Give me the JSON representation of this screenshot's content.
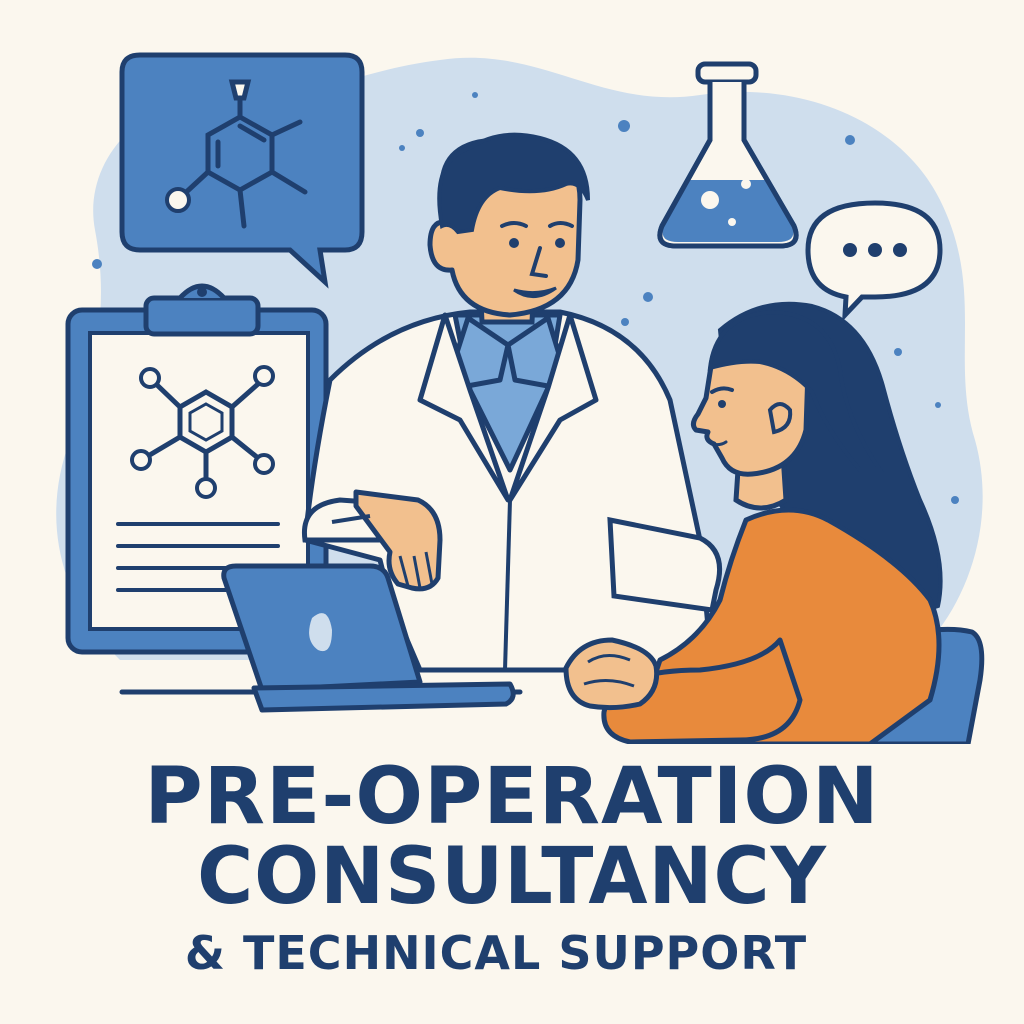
{
  "headline": {
    "line1": "PRE-OPERATION",
    "line2": "CONSULTANCY",
    "subtitle": "& TECHNICAL SUPPORT"
  },
  "colors": {
    "background": "#fbf7ee",
    "navy": "#1f3f6e",
    "blue": "#4c82c0",
    "light_blue": "#cfdeed",
    "orange": "#e88a3c",
    "skin": "#f2c08e"
  },
  "icons": [
    "chat-bubble-molecule-icon",
    "flask-icon",
    "ellipsis-bubble-icon",
    "clipboard-molecule-icon",
    "laptop-icon",
    "chair-icon"
  ]
}
